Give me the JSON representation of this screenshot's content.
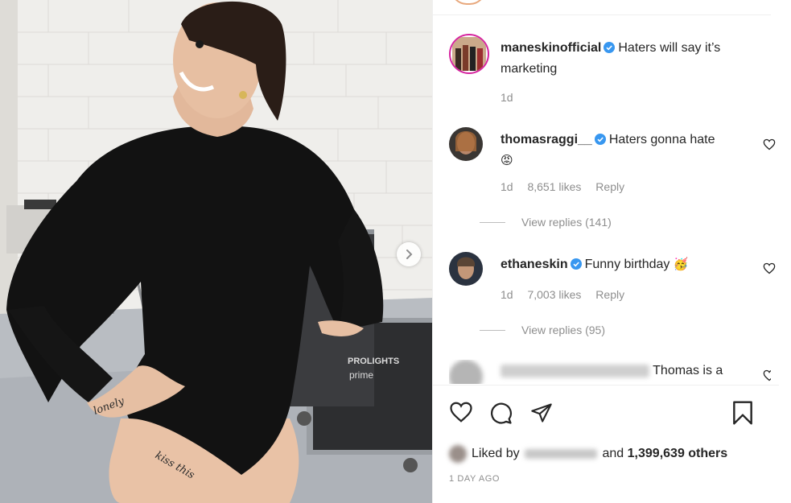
{
  "post": {
    "author": {
      "username": "maneskinofficial",
      "verified": true,
      "caption": "Haters will say it’s marketing",
      "time": "1d"
    },
    "photo": {
      "next_icon": "chevron-right-icon",
      "tattoo_arm": "lonely",
      "tattoo_hip": "kiss this",
      "case_label_1": "PROLIGHTS",
      "case_label_2": "prime"
    },
    "comments": [
      {
        "username": "thomasraggi__",
        "verified": true,
        "text": "Haters gonna hate",
        "emoji": "😡",
        "time": "1d",
        "likes": "8,651 likes",
        "reply": "Reply",
        "view_replies": "View replies (141)"
      },
      {
        "username": "ethaneskin",
        "verified": true,
        "text": "Funny birthday",
        "emoji": "🥳",
        "time": "1d",
        "likes": "7,003 likes",
        "reply": "Reply",
        "view_replies": "View replies (95)"
      },
      {
        "username": "hidden_username",
        "text": "Thomas is a"
      }
    ],
    "liked_by_prefix": "Liked by",
    "liked_by_user": "hidden_user",
    "liked_by_and": "and",
    "liked_by_others": "1,399,639 others",
    "date": "1 DAY AGO"
  },
  "icons": {
    "like": "heart-icon",
    "comment": "comment-icon",
    "share": "paper-plane-icon",
    "save": "bookmark-icon",
    "verified": "verified-badge-icon"
  },
  "colors": {
    "verified": "#3897f0",
    "text": "#262626",
    "muted": "#8e8e8e",
    "story_ring": "#d6249f"
  }
}
